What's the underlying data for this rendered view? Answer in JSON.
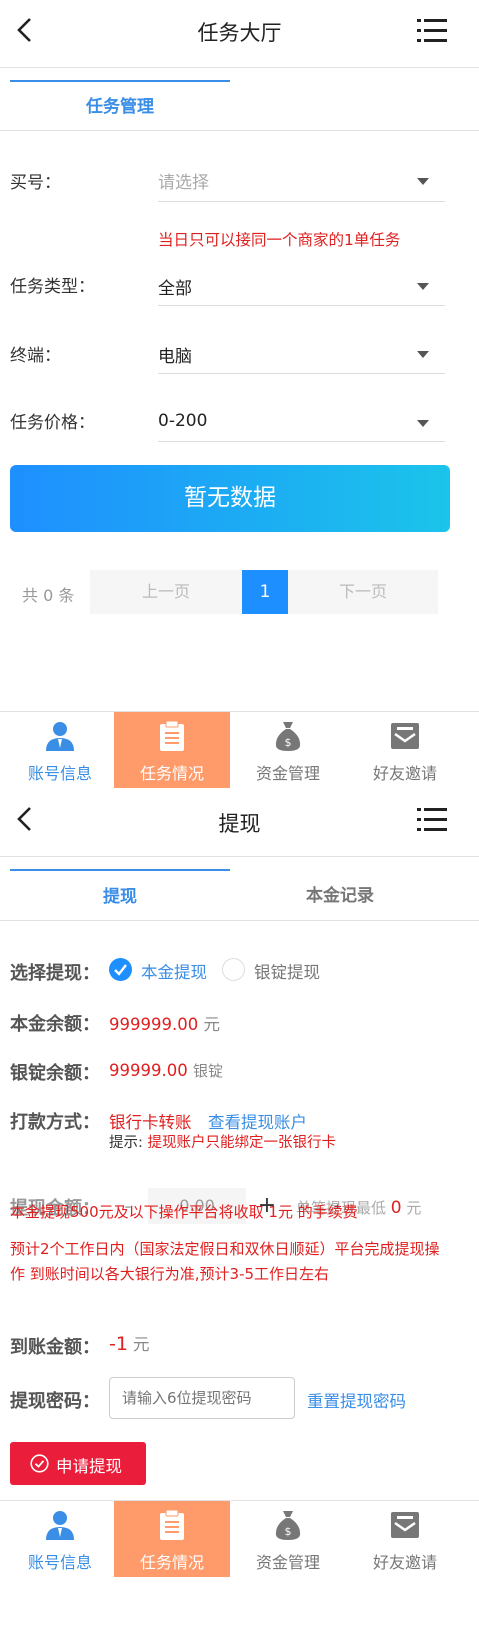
{
  "screen1": {
    "title": "任务大厅",
    "tab": "任务管理",
    "fields": {
      "account": {
        "label": "买号：",
        "placeholder": "请选择"
      },
      "notice": "当日只可以接同一个商家的1单任务",
      "task_type": {
        "label": "任务类型：",
        "value": "全部"
      },
      "terminal": {
        "label": "终端：",
        "value": "电脑"
      },
      "price": {
        "label": "任务价格：",
        "value": "0-200"
      }
    },
    "no_data_button": "暂无数据",
    "pagination": {
      "total": "共 0 条",
      "prev": "上一页",
      "page": "1",
      "next": "下一页"
    }
  },
  "nav": {
    "items": [
      {
        "label": "账号信息",
        "icon": "user-icon"
      },
      {
        "label": "任务情况",
        "icon": "clipboard-icon"
      },
      {
        "label": "资金管理",
        "icon": "money-bag-icon"
      },
      {
        "label": "好友邀请",
        "icon": "envelope-icon"
      }
    ]
  },
  "screen2": {
    "title": "提现",
    "tabs": [
      "提现",
      "本金记录"
    ],
    "select_label": "选择提现：",
    "option1": "本金提现",
    "option2": "银锭提现",
    "principal_label": "本金余额：",
    "principal_value": "999999.00",
    "principal_unit": "元",
    "ingot_label": "银锭余额：",
    "ingot_value": "99999.00",
    "ingot_unit": "银锭",
    "pay_label": "打款方式：",
    "pay_value": "银行卡转账",
    "pay_link": "查看提现账户",
    "pay_tip_prefix": "提示:",
    "pay_tip": "提现账户只能绑定一张银行卡",
    "amount_label": "提现金额：",
    "amount_minus": "-",
    "amount_value": "0.00",
    "amount_plus": "+",
    "min_text": "单笔提现最低",
    "min_value": "0",
    "min_unit": "元",
    "fee_text": "本金提现500元及以下操作平台将收取 1元 的手续费",
    "notice_text": "预计2个工作日内（国家法定假日和双休日顺延）平台完成提现操作 到账时间以各大银行为准,预计3-5工作日左右",
    "arrive_label": "到账金额：",
    "arrive_value": "-1",
    "arrive_unit": "元",
    "pwd_label": "提现密码：",
    "pwd_placeholder": "请输入6位提现密码",
    "reset_link": "重置提现密码",
    "submit": "申请提现"
  },
  "colors": {
    "accent_blue": "#1e8fff",
    "accent_cyan": "#1bc4ea",
    "nav_active": "#ff9a6a",
    "red": "#e02020",
    "link_blue": "#3a8ee6",
    "submit_red": "#ea1d3a"
  }
}
